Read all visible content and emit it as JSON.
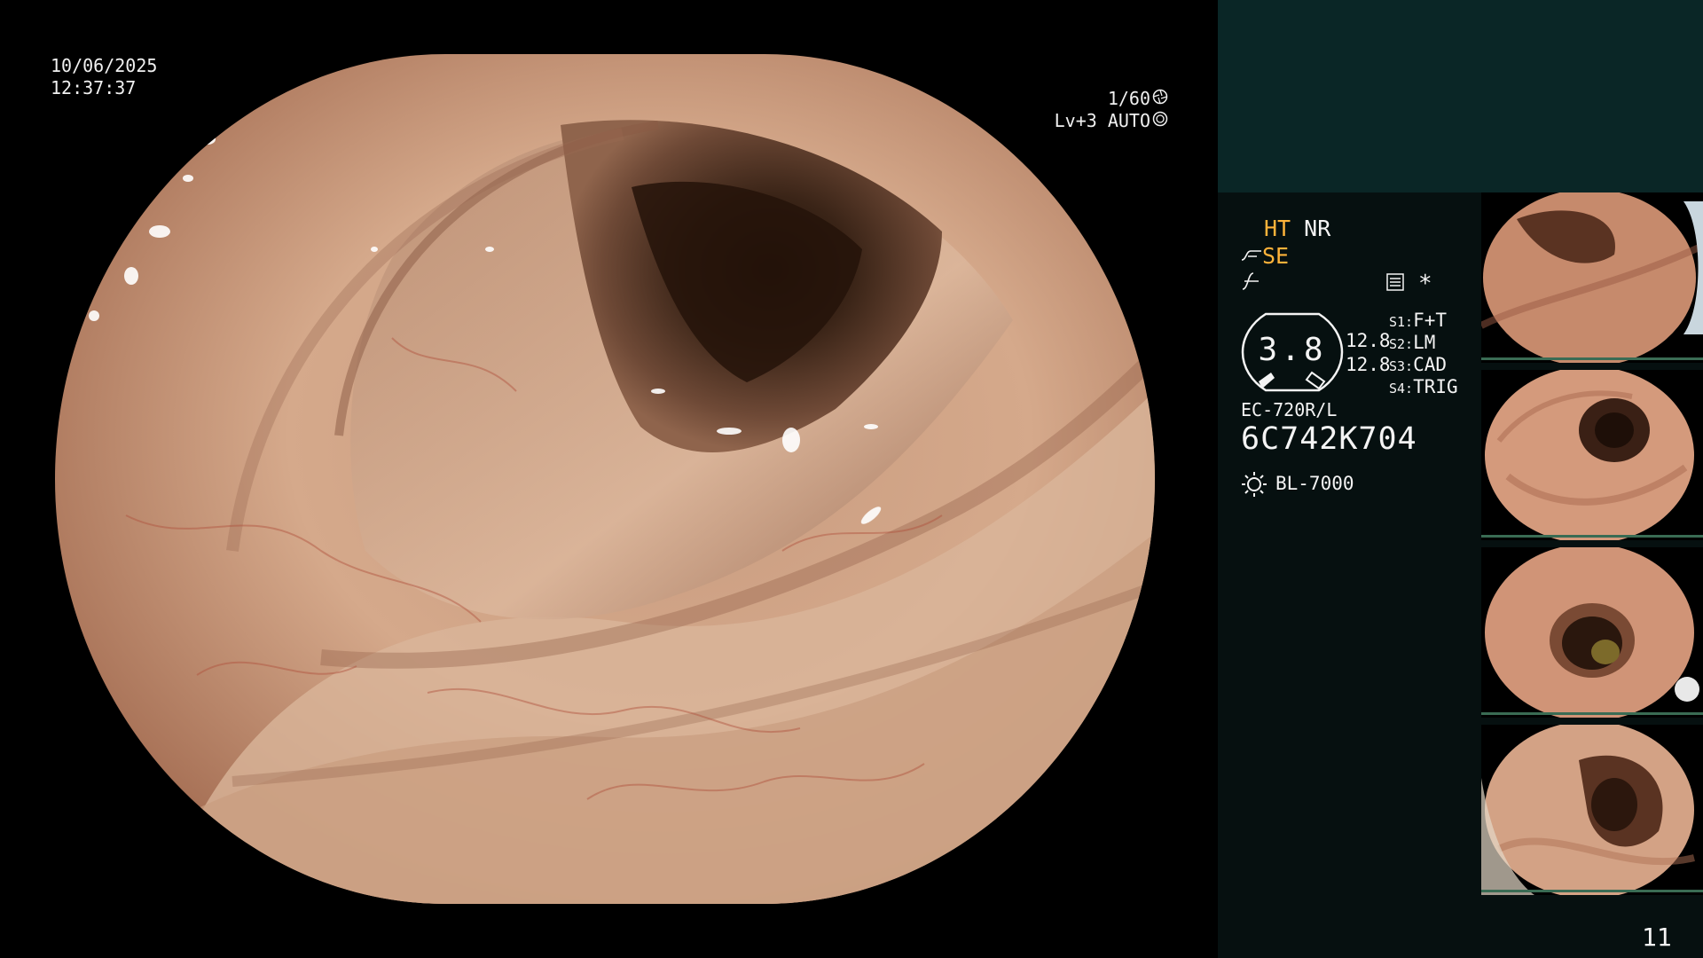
{
  "overlay": {
    "date": "10/06/2025",
    "time": "12:37:37",
    "shutter": "1/60",
    "level": "Lv+3 AUTO"
  },
  "panel": {
    "mode_ht": "HT",
    "mode_nr": "NR",
    "mode_se": "SE",
    "asterisk": "*",
    "gauge_value": "3.8",
    "value_a": "12.8",
    "value_b": "12.8",
    "settings": [
      {
        "key": "S1:",
        "value": "F+T"
      },
      {
        "key": "S2:",
        "value": "LM"
      },
      {
        "key": "S3:",
        "value": "CAD"
      },
      {
        "key": "S4:",
        "value": "TRIG"
      }
    ],
    "scope_model": "EC-720R/L",
    "scope_serial": "6C742K704",
    "light_source": "BL-7000",
    "frame_number": "11"
  },
  "colors": {
    "accent_orange": "#ffb33a",
    "panel_top": "#0a2626",
    "panel_bottom": "#061010",
    "thumb_divider": "#3a6c54"
  },
  "icons": {
    "shutter": "shutter-aperture-icon",
    "auto": "auto-exposure-icon",
    "light": "sun-icon",
    "settings": "settings-list-icon"
  }
}
